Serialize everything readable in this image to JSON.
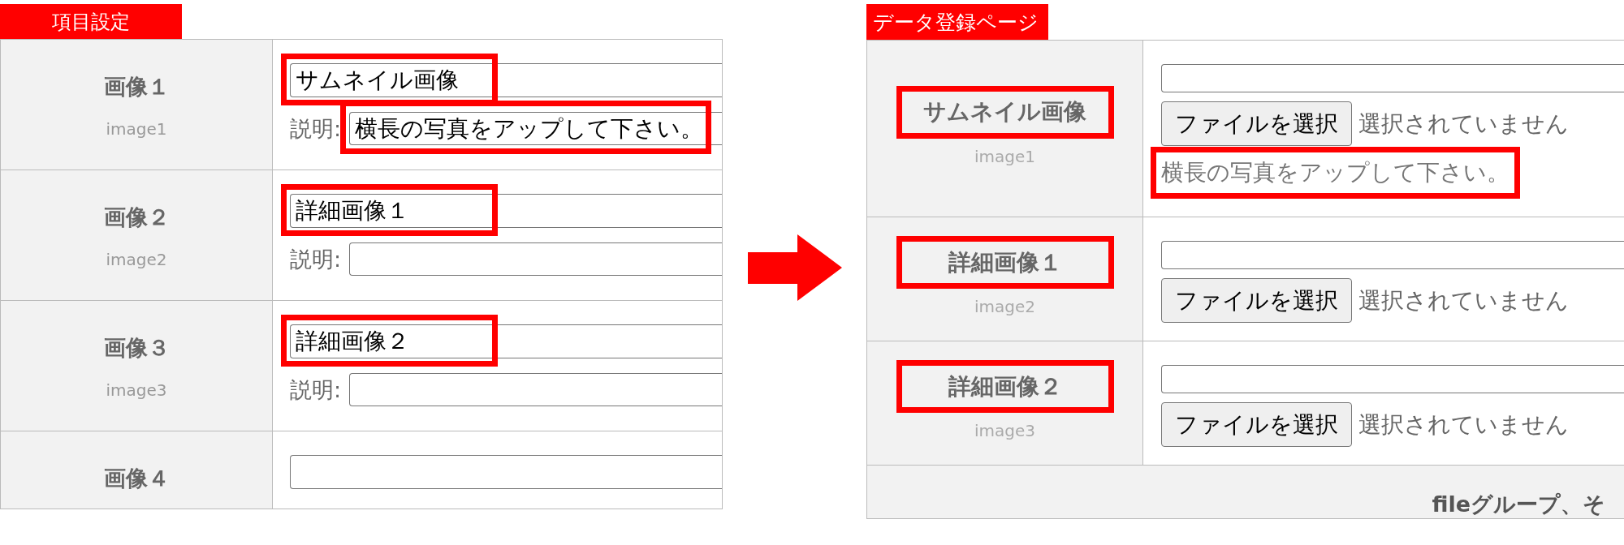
{
  "left_panel": {
    "title": "項目設定",
    "rows": [
      {
        "label": "画像１",
        "sublabel": "image1",
        "name_field": {
          "value": "サムネイル画像",
          "highlighted": true
        },
        "description": {
          "label": "説明:",
          "field": {
            "value": "横長の写真をアップして下さい。",
            "highlighted": true
          }
        }
      },
      {
        "label": "画像２",
        "sublabel": "image2",
        "name_field": {
          "value": "詳細画像１",
          "highlighted": true
        },
        "description": {
          "label": "説明:",
          "field": {
            "highlighted": false
          }
        }
      },
      {
        "label": "画像３",
        "sublabel": "image3",
        "name_field": {
          "value": "詳細画像２",
          "highlighted": true
        },
        "description": {
          "label": "説明:",
          "field": {
            "highlighted": false
          }
        }
      },
      {
        "label": "画像４",
        "name_field": {
          "highlighted": false
        }
      }
    ]
  },
  "right_panel": {
    "title": "データ登録ページ",
    "rows": [
      {
        "label": "サムネイル画像",
        "label_highlighted": true,
        "sublabel": "image1",
        "file_button": "ファイルを選択",
        "file_status": "選択されていません",
        "note": "横長の写真をアップして下さい。",
        "note_highlighted": true
      },
      {
        "label": "詳細画像１",
        "label_highlighted": true,
        "sublabel": "image2",
        "file_button": "ファイルを選択",
        "file_status": "選択されていません"
      },
      {
        "label": "詳細画像２",
        "label_highlighted": true,
        "sublabel": "image3",
        "file_button": "ファイルを選択",
        "file_status": "選択されていません"
      }
    ],
    "footer": "fileグループ、そ"
  }
}
